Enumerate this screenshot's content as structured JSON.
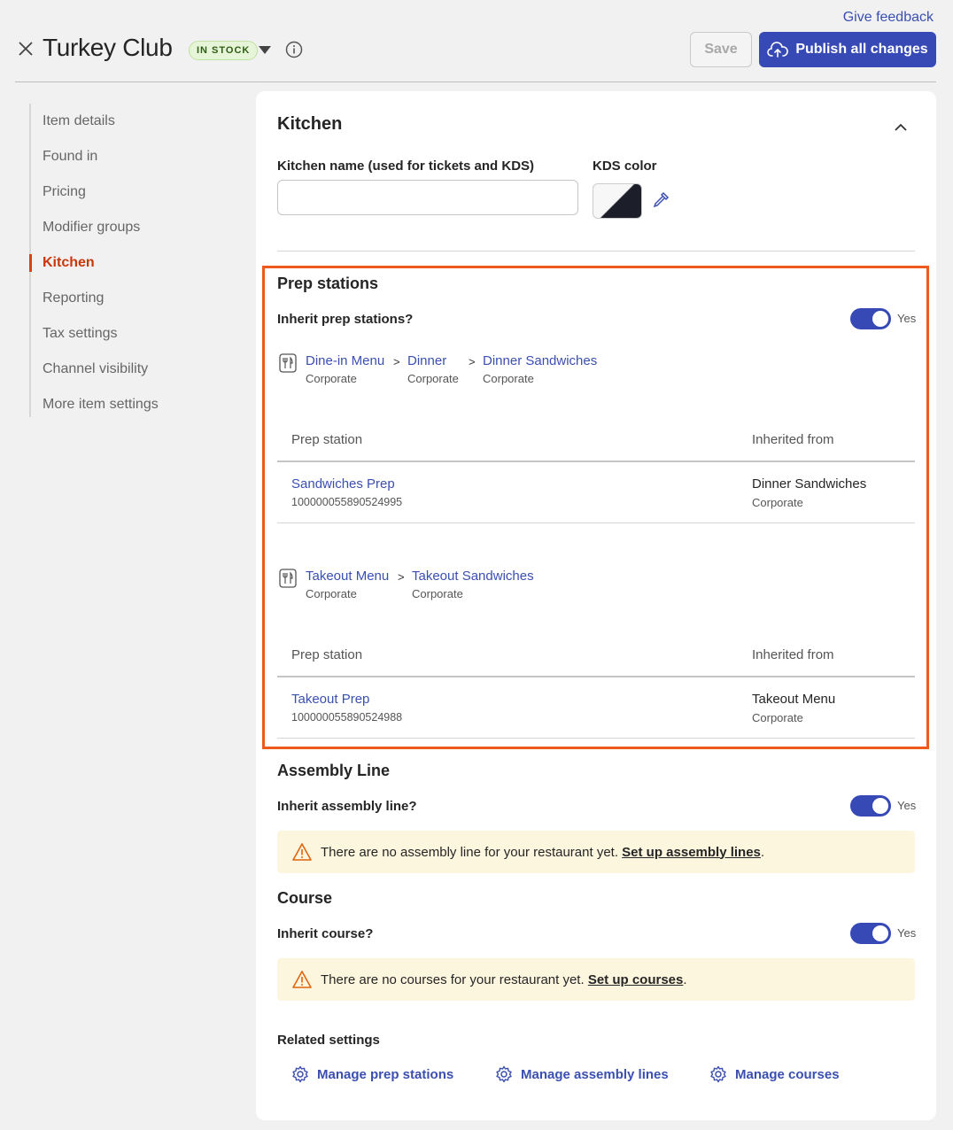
{
  "header": {
    "feedback": "Give feedback",
    "title": "Turkey Club",
    "badge": "IN STOCK",
    "save": "Save",
    "publish": "Publish all changes"
  },
  "sidebar": {
    "items": [
      {
        "label": "Item details"
      },
      {
        "label": "Found in"
      },
      {
        "label": "Pricing"
      },
      {
        "label": "Modifier groups"
      },
      {
        "label": "Kitchen"
      },
      {
        "label": "Reporting"
      },
      {
        "label": "Tax settings"
      },
      {
        "label": "Channel visibility"
      },
      {
        "label": "More item settings"
      }
    ],
    "active": "Kitchen"
  },
  "kitchen": {
    "heading": "Kitchen",
    "name_label": "Kitchen name (used for tickets and KDS)",
    "name_value": "",
    "kds_label": "KDS color"
  },
  "prep": {
    "heading": "Prep stations",
    "inherit_label": "Inherit prep stations?",
    "inherit_value": "Yes",
    "paths": [
      {
        "crumbs": [
          {
            "name": "Dine-in Menu",
            "sub": "Corporate"
          },
          {
            "name": "Dinner",
            "sub": "Corporate"
          },
          {
            "name": "Dinner Sandwiches",
            "sub": "Corporate"
          }
        ],
        "col_station": "Prep station",
        "col_from": "Inherited from",
        "row": {
          "name": "Sandwiches Prep",
          "id": "100000055890524995",
          "from": "Dinner Sandwiches",
          "from_sub": "Corporate"
        }
      },
      {
        "crumbs": [
          {
            "name": "Takeout Menu",
            "sub": "Corporate"
          },
          {
            "name": "Takeout Sandwiches",
            "sub": "Corporate"
          }
        ],
        "col_station": "Prep station",
        "col_from": "Inherited from",
        "row": {
          "name": "Takeout Prep",
          "id": "100000055890524988",
          "from": "Takeout Menu",
          "from_sub": "Corporate"
        }
      }
    ],
    "sep": ">"
  },
  "assembly": {
    "heading": "Assembly Line",
    "inherit_label": "Inherit assembly line?",
    "inherit_value": "Yes",
    "warning": "There are no assembly line for your restaurant yet.",
    "warning_link": "Set up assembly lines",
    "warning_end": "."
  },
  "course": {
    "heading": "Course",
    "inherit_label": "Inherit course?",
    "inherit_value": "Yes",
    "warning": "There are no courses for your restaurant yet.",
    "warning_link": "Set up courses",
    "warning_end": "."
  },
  "related": {
    "heading": "Related settings",
    "links": [
      {
        "label": "Manage prep stations"
      },
      {
        "label": "Manage assembly lines"
      },
      {
        "label": "Manage courses"
      }
    ]
  },
  "colors": {
    "accent": "#3649b5",
    "active_nav": "#c8370c",
    "highlight": "#ef5a1c",
    "badge_bg": "#e6f5d8",
    "warning_bg": "#fdf6df"
  },
  "icons": [
    "close-icon",
    "caret-down-icon",
    "info-icon",
    "cloud-upload-icon",
    "chevron-up-icon",
    "eyedropper-icon",
    "menu-icon",
    "warning-icon",
    "gear-icon"
  ]
}
